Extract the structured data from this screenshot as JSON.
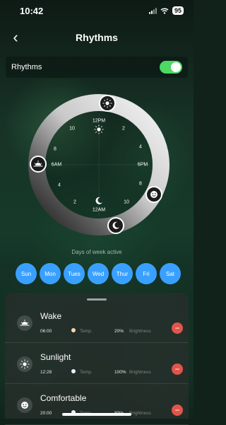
{
  "status_bar": {
    "time": "10:42",
    "battery": "95"
  },
  "header": {
    "title": "Rhythms",
    "back_icon": "chevron-left-icon"
  },
  "toggle": {
    "label": "Rhythms",
    "enabled": true
  },
  "dial": {
    "top_label": "12PM",
    "bottom_label": "12AM",
    "left_label": "6AM",
    "right_label": "6PM",
    "hours": [
      "2",
      "4",
      "8",
      "10",
      "2",
      "4",
      "8",
      "10"
    ],
    "markers": [
      "sun-icon",
      "sunrise-icon",
      "smiley-icon",
      "moon-icon"
    ]
  },
  "days": {
    "caption": "Days of week active",
    "list": [
      "Sun",
      "Mon",
      "Tues",
      "Wed",
      "Thur",
      "Fri",
      "Sat"
    ]
  },
  "items": [
    {
      "name": "Wake",
      "time": "06:00",
      "temp_label": "Temp.",
      "brightness": "20%",
      "brightness_label": "Brightness",
      "icon": "sunrise-icon"
    },
    {
      "name": "Sunlight",
      "time": "12:28",
      "temp_label": "Temp.",
      "brightness": "100%",
      "brightness_label": "Brightness",
      "icon": "sun-icon"
    },
    {
      "name": "Comfortable",
      "time": "20:00",
      "temp_label": "Temp.",
      "brightness": "80%",
      "brightness_label": "Brightness",
      "icon": "smiley-icon"
    }
  ],
  "colors": {
    "accent_blue": "#3aa0ff",
    "toggle_green": "#4cd964",
    "remove_red": "#e0554a"
  }
}
